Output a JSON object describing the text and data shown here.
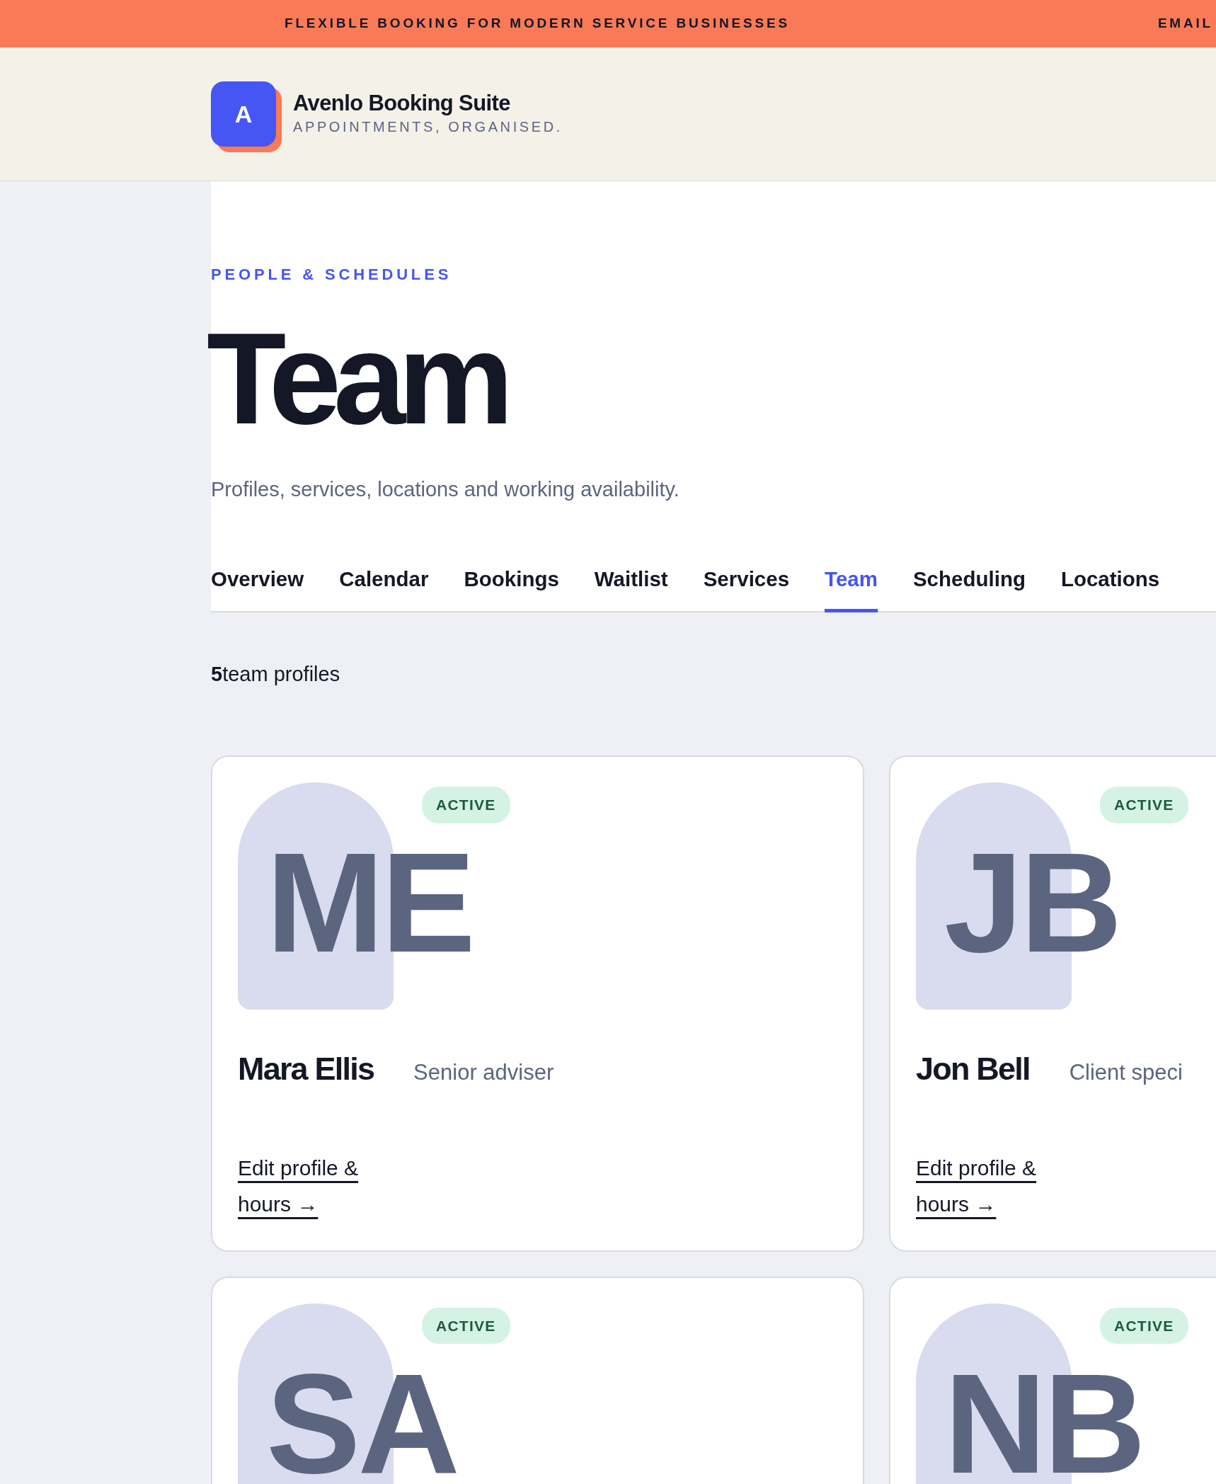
{
  "banner": {
    "text": "FLEXIBLE BOOKING FOR MODERN SERVICE BUSINESSES",
    "link": "EMAIL"
  },
  "brand": {
    "logo_letter": "A",
    "name": "Avenlo Booking Suite",
    "tagline": "APPOINTMENTS, ORGANISED."
  },
  "page": {
    "eyebrow": "PEOPLE & SCHEDULES",
    "title": "Team",
    "subtitle": "Profiles, services, locations and working availability."
  },
  "tabs": [
    {
      "label": "Overview",
      "selected": false
    },
    {
      "label": "Calendar",
      "selected": false
    },
    {
      "label": "Bookings",
      "selected": false
    },
    {
      "label": "Waitlist",
      "selected": false
    },
    {
      "label": "Services",
      "selected": false
    },
    {
      "label": "Team",
      "selected": true
    },
    {
      "label": "Scheduling",
      "selected": false
    },
    {
      "label": "Locations",
      "selected": false
    }
  ],
  "summary": "**5**team profiles",
  "members": [
    {
      "initials": "ME",
      "status": "ACTIVE",
      "name": "Mara Ellis",
      "role": "Senior adviser",
      "link": "Edit profile & hours →"
    },
    {
      "initials": "JB",
      "status": "ACTIVE",
      "name": "Jon Bell",
      "role": "Client speci",
      "link": "Edit profile & hours →"
    },
    {
      "initials": "SA",
      "status": "ACTIVE"
    },
    {
      "initials": "NB",
      "status": "ACTIVE"
    }
  ]
}
